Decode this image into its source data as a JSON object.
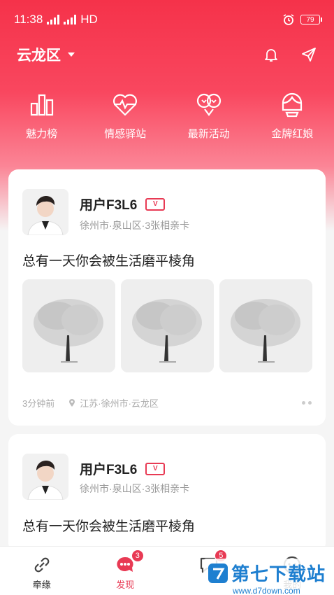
{
  "status_bar": {
    "time": "11:38",
    "network": "HD",
    "battery": "79"
  },
  "header": {
    "district": "云龙区"
  },
  "quick_actions": [
    {
      "label": "魅力榜",
      "icon": "bar-chart-icon"
    },
    {
      "label": "情感驿站",
      "icon": "heartbeat-icon"
    },
    {
      "label": "最新活动",
      "icon": "couple-heart-icon"
    },
    {
      "label": "金牌红娘",
      "icon": "matchmaker-icon"
    }
  ],
  "posts": [
    {
      "username": "用户F3L6",
      "meta": "徐州市·泉山区·3张相亲卡",
      "text": "总有一天你会被生活磨平棱角",
      "time_ago": "3分钟前",
      "location": "江苏·徐州市·云龙区"
    },
    {
      "username": "用户F3L6",
      "meta": "徐州市·泉山区·3张相亲卡",
      "text": "总有一天你会被生活磨平棱角"
    }
  ],
  "tabs": [
    {
      "label": "牵缘",
      "icon": "link-icon"
    },
    {
      "label": "发现",
      "icon": "discover-icon",
      "badge": "3"
    },
    {
      "label": "",
      "icon": "message-icon",
      "badge": "5"
    },
    {
      "label": "我的",
      "icon": "profile-icon"
    }
  ],
  "watermark": {
    "brand": "第七下载站",
    "url": "www.d7down.com"
  },
  "colors": {
    "accent": "#e83a54",
    "watermark": "#1e7fd0"
  }
}
